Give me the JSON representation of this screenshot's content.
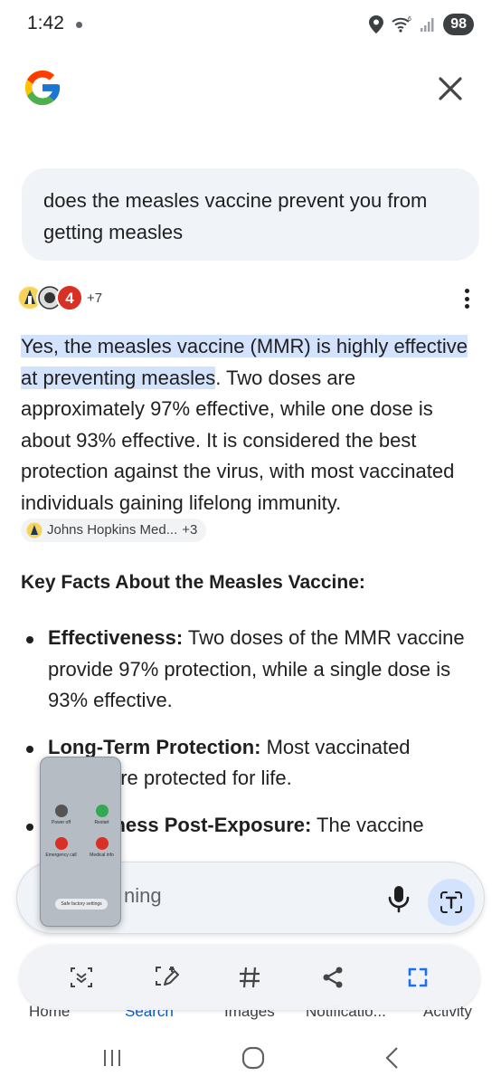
{
  "status_bar": {
    "time": "1:42",
    "battery": "98"
  },
  "query": "does the measles vaccine prevent you from getting measles",
  "sources": {
    "more_count": "+7"
  },
  "answer": {
    "highlight": "Yes, the measles vaccine (MMR) is highly effective at preventing measles",
    "body": ". Two doses are approximately 97% effective, while one dose is about 93% effective. It is considered the best protection against the virus, with most vaccinated individuals gaining lifelong immunity.",
    "citation": {
      "label": "Johns Hopkins Med...",
      "more": "+3"
    }
  },
  "key_facts": {
    "heading": "Key Facts About the Measles Vaccine:",
    "items": [
      {
        "term": "Effectiveness:",
        "text": " Two doses of the MMR vaccine provide 97% protection, while a single dose is 93% effective."
      },
      {
        "term": "Long-Term Protection:",
        "text": " Most vaccinated ",
        "tail": "are protected for life."
      },
      {
        "term_visible": "veness Post-Exposure:",
        "text": " The vaccine"
      }
    ]
  },
  "ask_bar": {
    "placeholder_visible": "ning"
  },
  "power_menu_thumbnail": {
    "power_off": "Power off",
    "restart": "Restart",
    "emergency_call": "Emergency call",
    "medical_info": "Medical info",
    "safe_factory": "Safe factory settings"
  },
  "bottom_nav": {
    "items": [
      "Home",
      "Search",
      "Images",
      "Notificatio...",
      "Activity"
    ],
    "active": "Search"
  },
  "colors": {
    "accent": "#0b57d0",
    "highlight": "#d3e3fd",
    "bubble": "#f0f3f8"
  }
}
